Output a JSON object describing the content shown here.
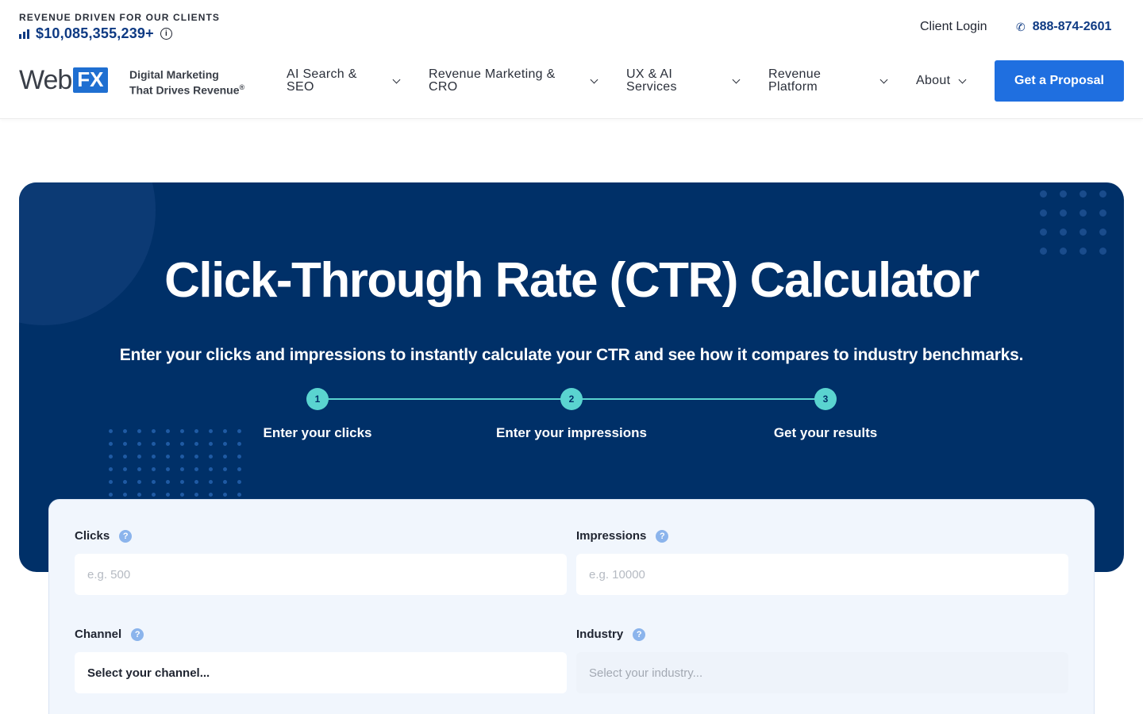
{
  "header": {
    "revenue_label": "REVENUE DRIVEN FOR OUR CLIENTS",
    "revenue_amount": "$10,085,355,239+",
    "client_login": "Client Login",
    "phone": "888-874-2601",
    "logo_web": "Web",
    "logo_fx": "FX",
    "tagline_line1": "Digital Marketing",
    "tagline_line2": "That Drives Revenue",
    "tagline_mark": "®",
    "nav": [
      {
        "line1": "AI Search &",
        "line2": "SEO"
      },
      {
        "line1": "Revenue Marketing &",
        "line2": "CRO"
      },
      {
        "line1": "UX & AI",
        "line2": "Services"
      },
      {
        "line1": "Revenue",
        "line2": "Platform"
      },
      {
        "line1": "About",
        "line2": ""
      }
    ],
    "cta": "Get a Proposal",
    "colors": {
      "brand_blue": "#0e3a83",
      "cta_blue": "#1f6fe0"
    }
  },
  "hero": {
    "title": "Click-Through Rate (CTR) Calculator",
    "subtitle": "Enter your clicks and impressions to instantly calculate your CTR and see how it compares to industry benchmarks.",
    "steps": [
      {
        "num": "1",
        "label": "Enter your clicks"
      },
      {
        "num": "2",
        "label": "Enter your impressions"
      },
      {
        "num": "3",
        "label": "Get your results"
      }
    ],
    "colors": {
      "background": "#003068",
      "accent": "#5ad4d0"
    }
  },
  "form": {
    "clicks_label": "Clicks",
    "clicks_placeholder": "e.g. 500",
    "impressions_label": "Impressions",
    "impressions_placeholder": "e.g. 10000",
    "channel_label": "Channel",
    "channel_value": "Select your channel...",
    "industry_label": "Industry",
    "industry_value": "Select your industry..."
  }
}
